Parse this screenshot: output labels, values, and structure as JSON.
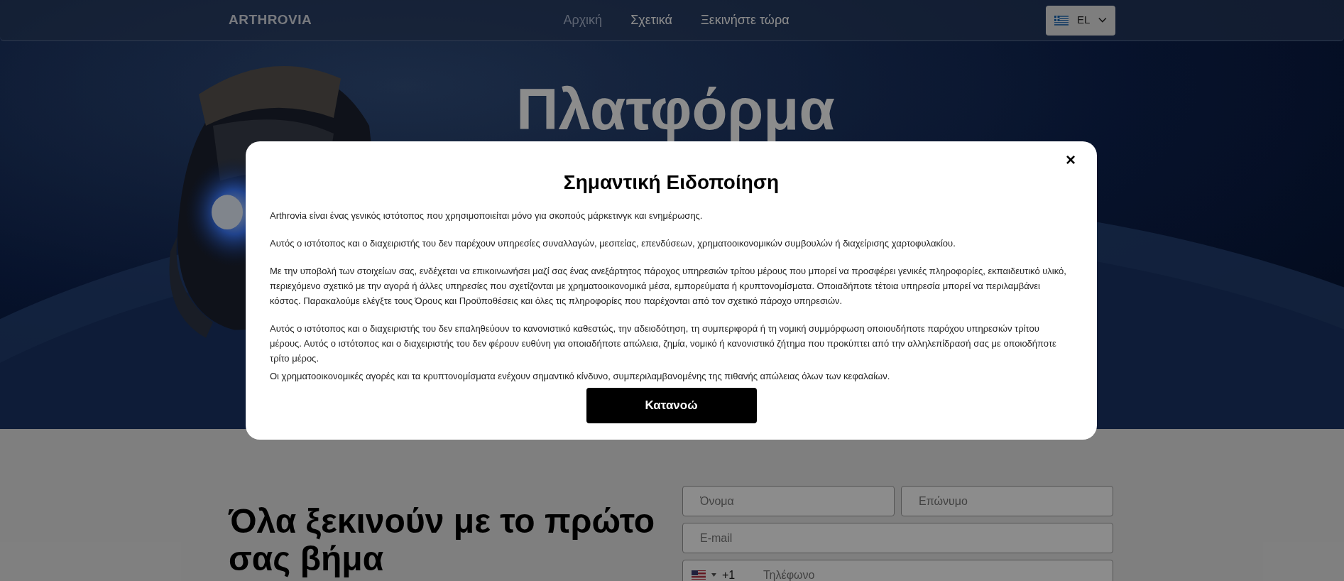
{
  "nav": {
    "logo": "ARTHROVIA",
    "links": [
      {
        "label": "Αρχική",
        "selected": true
      },
      {
        "label": "Σχετικά",
        "selected": false
      },
      {
        "label": "Ξεκινήστε τώρα",
        "selected": false
      }
    ],
    "language": "EL"
  },
  "hero": {
    "title": "Πλατφόρμα"
  },
  "signup": {
    "heading": "Όλα ξεκινούν με το πρώτο σας βήμα",
    "first_name": {
      "placeholder": "Όνομα"
    },
    "last_name": {
      "placeholder": "Επώνυμο"
    },
    "email": {
      "placeholder": "E-mail"
    },
    "phone": {
      "code": "+1",
      "placeholder": "Τηλέφωνο"
    }
  },
  "modal": {
    "close": "×",
    "title": "Σημαντική Ειδοποίηση",
    "paragraphs": [
      "Arthrovia είναι ένας γενικός ιστότοπος που χρησιμοποιείται μόνο για σκοπούς μάρκετινγκ και ενημέρωσης.",
      "Αυτός ο ιστότοπος και ο διαχειριστής του δεν παρέχουν υπηρεσίες συναλλαγών, μεσιτείας, επενδύσεων, χρηματοοικονομικών συμβουλών ή διαχείρισης χαρτοφυλακίου.",
      "Με την υποβολή των στοιχείων σας, ενδέχεται να επικοινωνήσει μαζί σας ένας ανεξάρτητος πάροχος υπηρεσιών τρίτου μέρους που μπορεί να προσφέρει γενικές πληροφορίες, εκπαιδευτικό υλικό, περιεχόμενο σχετικό με την αγορά ή άλλες υπηρεσίες που σχετίζονται με χρηματοοικονομικά μέσα, εμπορεύματα ή κρυπτονομίσματα. Οποιαδήποτε τέτοια υπηρεσία μπορεί να περιλαμβάνει κόστος. Παρακαλούμε ελέγξτε τους Όρους και Προϋποθέσεις και όλες τις πληροφορίες που παρέχονται από τον σχετικό πάροχο υπηρεσιών.",
      "Αυτός ο ιστότοπος και ο διαχειριστής του δεν επαληθεύουν το κανονιστικό καθεστώς, την αδειοδότηση, τη συμπεριφορά ή τη νομική συμμόρφωση οποιουδήποτε παρόχου υπηρεσιών τρίτου μέρους. Αυτός ο ιστότοπος και ο διαχειριστής του δεν φέρουν ευθύνη για οποιαδήποτε απώλεια, ζημία, νομικό ή κανονιστικό ζήτημα που προκύπτει από την αλληλεπίδρασή σας με οποιοδήποτε τρίτο μέρος.",
      "Οι χρηματοοικονομικές αγορές και τα κρυπτονομίσματα ενέχουν σημαντικό κίνδυνο, συμπεριλαμβανομένης της πιθανής απώλειας όλων των κεφαλαίων."
    ],
    "button": "Κατανοώ"
  }
}
